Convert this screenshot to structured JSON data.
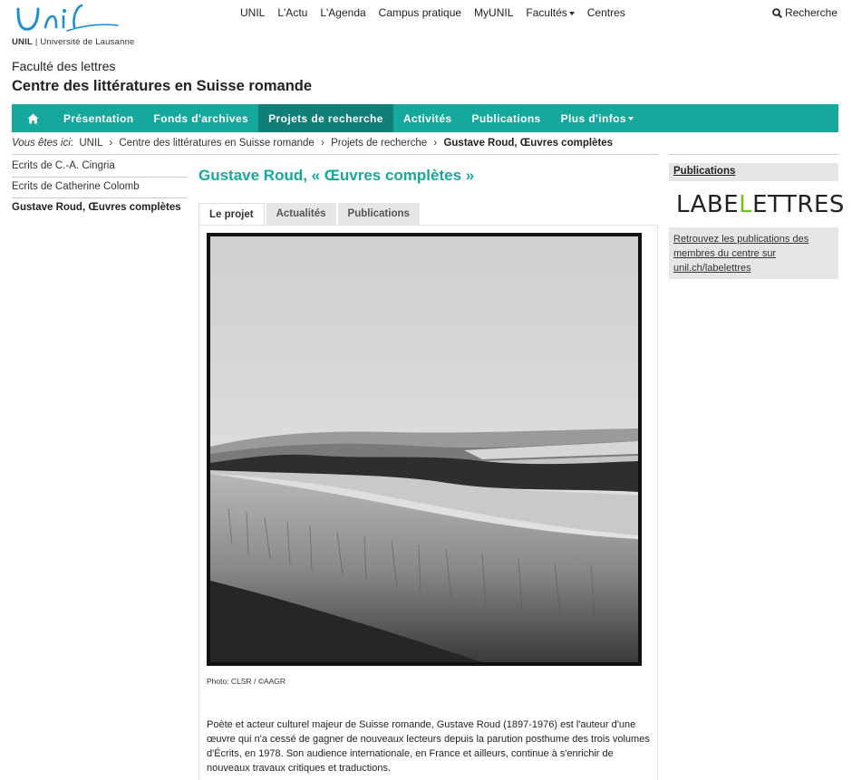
{
  "header": {
    "logo_text": "Unil",
    "logo_sub_bold": "UNIL",
    "logo_sub": "| Université de Lausanne",
    "topnav": [
      "UNIL",
      "L'Actu",
      "L'Agenda",
      "Campus pratique",
      "MyUNIL",
      "Facultés",
      "Centres"
    ],
    "search_label": "Recherche",
    "faculty": "Faculté des lettres",
    "centre": "Centre des littératures en Suisse romande"
  },
  "mainnav": {
    "items": [
      "Présentation",
      "Fonds d'archives",
      "Projets de recherche",
      "Activités",
      "Publications",
      "Plus d'infos"
    ],
    "active": "Projets de recherche"
  },
  "breadcrumb": {
    "prefix": "Vous êtes ici",
    "items": [
      "UNIL",
      "Centre des littératures en Suisse romande",
      "Projets de recherche"
    ],
    "current": "Gustave Roud, Œuvres complètes"
  },
  "sidenav": {
    "items": [
      "Ecrits de C.-A. Cingria",
      "Ecrits de Catherine Colomb",
      "Gustave Roud, Œuvres complètes"
    ]
  },
  "content": {
    "title": "Gustave Roud, « Œuvres complètes »",
    "tabs": [
      "Le projet",
      "Actualités",
      "Publications"
    ],
    "caption": "Photo: CLSR / ©AAGR",
    "paragraph": "Poète et acteur culturel majeur de Suisse romande, Gustave Roud (1897-1976) est l'auteur d'une œuvre qui n'a cessé de gagner de nouveaux lecteurs depuis la parution posthume des trois volumes d'Écrits, en 1978. Son audience internationale, en France et ailleurs, continue à s'enrichir de nouveaux travaux critiques et traductions."
  },
  "right": {
    "box_title": "Publications",
    "brand_pre": "LABE",
    "brand_hl": "L",
    "brand_post": "ETTRES",
    "link_text": "Retrouvez les publications des membres du centre sur unil.ch/labelettres"
  },
  "colors": {
    "brand_teal": "#16a89d",
    "nav_active": "#0f7f77",
    "logo_blue": "#1d8fd0",
    "labelettres_green": "#6dc21d"
  }
}
